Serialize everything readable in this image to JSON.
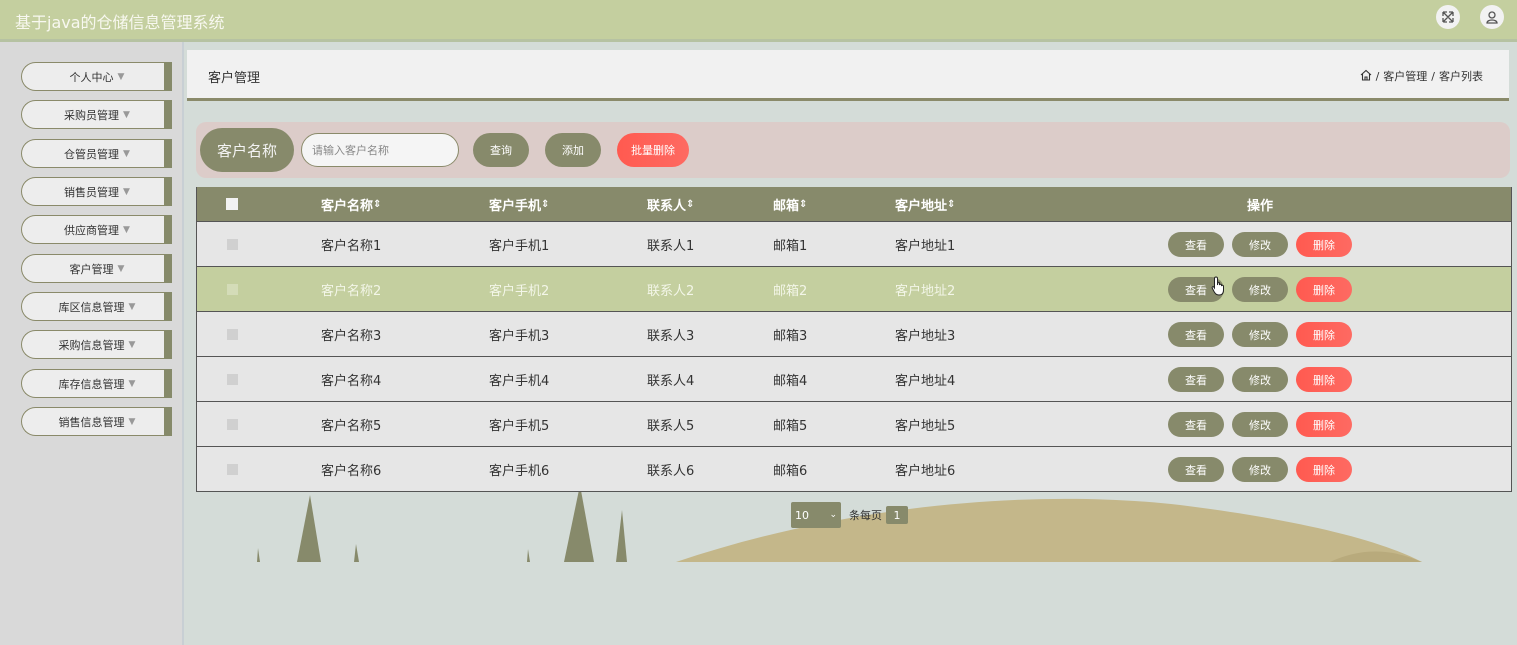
{
  "app": {
    "title": "基于java的仓储信息管理系统"
  },
  "header_icons": [
    "fullscreen-icon",
    "user-icon"
  ],
  "sidebar": {
    "items": [
      {
        "label": "个人中心"
      },
      {
        "label": "采购员管理"
      },
      {
        "label": "仓管员管理"
      },
      {
        "label": "销售员管理"
      },
      {
        "label": "供应商管理"
      },
      {
        "label": "客户管理"
      },
      {
        "label": "库区信息管理"
      },
      {
        "label": "采购信息管理"
      },
      {
        "label": "库存信息管理"
      },
      {
        "label": "销售信息管理"
      }
    ]
  },
  "breadcrumb": {
    "page_title": "客户管理",
    "trail": [
      "客户管理",
      "客户列表"
    ],
    "separator": "/"
  },
  "search": {
    "label": "客户名称",
    "placeholder": "请输入客户名称",
    "query_label": "查询",
    "add_label": "添加",
    "batch_delete_label": "批量删除"
  },
  "table": {
    "columns": [
      "客户名称",
      "客户手机",
      "联系人",
      "邮箱",
      "客户地址",
      "操作"
    ],
    "sort_glyph": "⇕",
    "rows": [
      {
        "name": "客户名称1",
        "phone": "客户手机1",
        "contact": "联系人1",
        "email": "邮箱1",
        "address": "客户地址1"
      },
      {
        "name": "客户名称2",
        "phone": "客户手机2",
        "contact": "联系人2",
        "email": "邮箱2",
        "address": "客户地址2"
      },
      {
        "name": "客户名称3",
        "phone": "客户手机3",
        "contact": "联系人3",
        "email": "邮箱3",
        "address": "客户地址3"
      },
      {
        "name": "客户名称4",
        "phone": "客户手机4",
        "contact": "联系人4",
        "email": "邮箱4",
        "address": "客户地址4"
      },
      {
        "name": "客户名称5",
        "phone": "客户手机5",
        "contact": "联系人5",
        "email": "邮箱5",
        "address": "客户地址5"
      },
      {
        "name": "客户名称6",
        "phone": "客户手机6",
        "contact": "联系人6",
        "email": "邮箱6",
        "address": "客户地址6"
      }
    ],
    "actions": {
      "view": "查看",
      "edit": "修改",
      "delete": "删除"
    },
    "highlighted_row_index": 1
  },
  "pagination": {
    "page_size": "10",
    "per_page_label": "条每页",
    "current_page": "1"
  },
  "colors": {
    "header_bg": "#c4cf9f",
    "olive": "#878a6b",
    "danger": "#ff5a50",
    "search_panel": "#dcccc9",
    "hill": "#c4b78a"
  }
}
